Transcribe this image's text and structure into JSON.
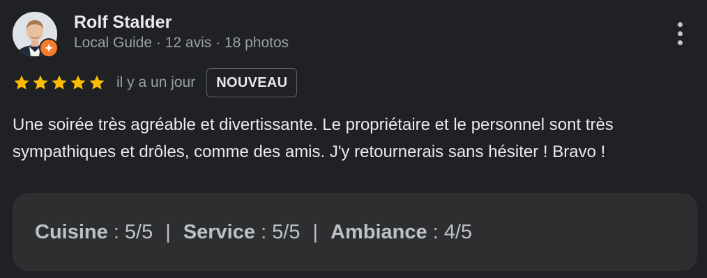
{
  "author": {
    "name": "Rolf Stalder",
    "meta": "Local Guide · 12 avis · 18 photos"
  },
  "review": {
    "rating": 5,
    "rating_max": 5,
    "time": "il y a un jour",
    "badge": "NOUVEAU",
    "text": "Une soirée très agréable et divertissante. Le propriétaire et le personnel sont très sympathiques et drôles, comme des amis. J'y retournerais sans hésiter ! Bravo !"
  },
  "sub_ratings": [
    {
      "label": "Cuisine",
      "value": ": 5/5"
    },
    {
      "label": "Service",
      "value": ": 5/5"
    },
    {
      "label": "Ambiance",
      "value": ": 4/5"
    }
  ],
  "separator": "|",
  "colors": {
    "background": "#202124",
    "star": "#fbbc04",
    "badge_orange": "#f57c2b",
    "ratings_box": "#2d2e30"
  },
  "icons": {
    "menu": "more-vertical-icon",
    "guide": "local-guide-badge-icon",
    "star": "star-icon"
  }
}
